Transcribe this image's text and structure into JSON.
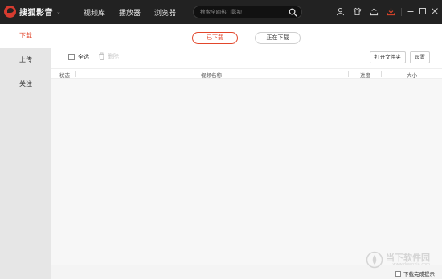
{
  "app": {
    "name": "搜狐影音"
  },
  "nav": [
    "视频库",
    "播放器",
    "浏览器"
  ],
  "search": {
    "placeholder": "搜索全网热门影视",
    "value": ""
  },
  "sidebar": {
    "items": [
      {
        "label": "下载",
        "active": true
      },
      {
        "label": "上传",
        "active": false
      },
      {
        "label": "关注",
        "active": false
      }
    ]
  },
  "tabs": [
    {
      "label": "已下载",
      "active": true
    },
    {
      "label": "正在下载",
      "active": false
    }
  ],
  "toolbar": {
    "select_all": "全选",
    "delete": "删除",
    "open_folder": "打开文件夹",
    "settings": "设置"
  },
  "table": {
    "columns": [
      "状态",
      "视频名称",
      "进度",
      "大小"
    ]
  },
  "footer": {
    "notify_label": "下载完成提示"
  },
  "watermark": {
    "name": "当下软件园",
    "url": "www.downxia.com"
  },
  "colors": {
    "accent": "#e2462b",
    "topbar": "#222222",
    "sidebar": "#e6e6e6"
  },
  "icons": [
    "search-icon",
    "user-icon",
    "shirt-icon",
    "upload-icon",
    "download-icon",
    "minimize-icon",
    "maximize-icon",
    "close-icon",
    "trash-icon"
  ]
}
